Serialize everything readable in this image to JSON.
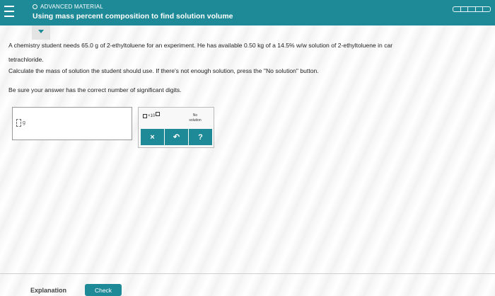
{
  "header": {
    "tag": "ADVANCED MATERIAL",
    "title": "Using mass percent composition to find solution volume"
  },
  "problem": {
    "line1": "A chemistry student needs 65.0 g of 2-ethyltoluene for an experiment. He has available 0.50 kg of a 14.5% w/w solution of 2-ethyltoluene in car",
    "line2": "tetrachloride.",
    "line3": "Calculate the mass of solution the student should use. If there's not enough solution, press the \"No solution\" button.",
    "line4": "Be sure your answer has the correct number of significant digits."
  },
  "answer": {
    "unit": "g"
  },
  "tools": {
    "sci_label": "×10",
    "no_solution_line1": "No",
    "no_solution_line2": "solution",
    "clear": "×",
    "undo": "↶",
    "help": "?"
  },
  "footer": {
    "explanation": "Explanation",
    "check": "Check"
  }
}
